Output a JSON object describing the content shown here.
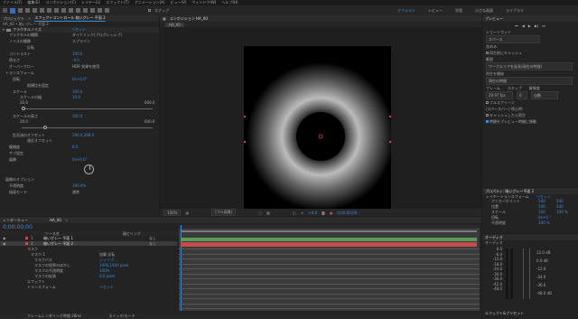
{
  "menu": [
    "ファイル(F)",
    "編集(E)",
    "コンポジション(C)",
    "レイヤー(L)",
    "エフェクト(T)",
    "アニメーション(A)",
    "ビュー(V)",
    "ウィンドウ(W)",
    "ヘルプ(H)"
  ],
  "toolbar": {
    "snap_label": "スナップ"
  },
  "workspaces": {
    "items": [
      "デフォルト",
      "レビュー",
      "学習",
      "小さな画面",
      "ライブラリ"
    ],
    "active": 0
  },
  "effects_panel": {
    "tabs": [
      "プロジェクト",
      "エフェクトコントロール 暗いグレー 平面 2"
    ],
    "breadcrumb": "HA_00 • 暗いグレー 平面 2",
    "effect_name": "フラクタルノイズ",
    "reset_label": "リセット",
    "rows": [
      {
        "label": "フラクタルの種類",
        "value": "ダイナミック(プログレッシブ)"
      },
      {
        "label": "ノイズの種類",
        "value": "スプライン"
      },
      {
        "label": "",
        "value": "反転"
      },
      {
        "label": "コントラスト",
        "value": "100.0"
      },
      {
        "label": "明るさ",
        "value": "-9.0"
      },
      {
        "label": "オーバーフロー",
        "value": "HDR 効果を使用"
      },
      {
        "label": "トランスフォーム",
        "value": ""
      },
      {
        "label": "回転",
        "value": "0x+0.0°"
      },
      {
        "label": "",
        "value": "縦横比を固定"
      },
      {
        "label": "スケール",
        "value": "100.0"
      },
      {
        "label": "スケールの幅",
        "value": "10.0"
      },
      {
        "label": "スケールの高さ",
        "value": "100.0"
      },
      {
        "label": "乱気流のオフセット",
        "value": "290.0,288.0"
      },
      {
        "label": "",
        "value": "遠近オフセット"
      },
      {
        "label": "複雑度",
        "value": "6.0"
      },
      {
        "label": "サブ設定",
        "value": ""
      },
      {
        "label": "展開",
        "value": "0x+0.0°"
      },
      {
        "label": "展開のオプション",
        "value": ""
      },
      {
        "label": "不透明度",
        "value": "100.0%"
      },
      {
        "label": "描画モード",
        "value": "通常"
      }
    ],
    "slider_min": "20.0",
    "slider_max": "600.0"
  },
  "composition_panel": {
    "tab": "コンポジション HA_00",
    "comp_tab": "HA_00",
    "zoom": "100%",
    "resolution": "(フル画質)",
    "timecode": "+0.0",
    "frame": "0;00;00;00"
  },
  "timeline_panel": {
    "tab": "レンダーキュー",
    "comp_tab": "HA_00",
    "timecode": "0;00;00;00",
    "columns": [
      "ソース名",
      "親とリンク"
    ],
    "layers": [
      {
        "num": "1",
        "name": "暗いグレー 平面 1",
        "parent": "なし",
        "color": "#c74b4b"
      },
      {
        "num": "2",
        "name": "暗いグレー 平面 2",
        "parent": "なし",
        "color": "#c74b4b"
      }
    ],
    "sub_rows": [
      {
        "label": "マスク",
        "value": ""
      },
      {
        "label": "マスク 1",
        "value": "加算    反転"
      },
      {
        "label": "マスクパス",
        "value": "シェイプ..."
      },
      {
        "label": "マスクの境界のぼかし",
        "value": "1000,1000 pixel"
      },
      {
        "label": "マスクの不透明度",
        "value": "100%"
      },
      {
        "label": "マスクの拡張",
        "value": "0.0 pixel"
      },
      {
        "label": "エフェクト",
        "value": ""
      },
      {
        "label": "トランスフォーム",
        "value": "リセット"
      }
    ],
    "footer_left": "フレームレンダリング時間  28ms",
    "footer_mid": "スイッチ/モード"
  },
  "preview_panel": {
    "title": "プレビュー",
    "shortcut_label": "ショートカット",
    "shortcut_value": "スペース",
    "include_label": "含める:",
    "cache_label": "再生前にキャッシュ",
    "range_label": "範囲",
    "range_value": "ワークエリアを延長(現在の時間)",
    "play_from_label": "再生を開始",
    "play_from_value": "現在の時間",
    "frame_label": "フレーム",
    "skip_label": "スキップ",
    "res_label": "解像度",
    "frame_value": "29.97 fps",
    "skip_value": "0",
    "res_value": "自動",
    "fullscreen": "フルスクリーン",
    "stop_label": "(スペースバー) 停止時:",
    "cache_option": "キャッシュしたら再生",
    "move_option": "時間をプレビュー時間に移動"
  },
  "properties_panel": {
    "title": "プロパティ: 暗いグレー平面 2",
    "section": "レイヤートランスフォーム",
    "reset": "リセット",
    "rows": [
      {
        "label": "アンカーポイント",
        "v1": "540",
        "v2": "540"
      },
      {
        "label": "位置",
        "v1": "540",
        "v2": "540"
      },
      {
        "label": "スケール",
        "v1": "100",
        "v2": "100 %"
      },
      {
        "label": "回転",
        "v1": "0x+0 °",
        "v2": ""
      },
      {
        "label": "不透明度",
        "v1": "100 %",
        "v2": ""
      }
    ]
  },
  "audio_panel": {
    "tab": "オーディオ",
    "title": "オーディオ",
    "levels": [
      "0.0",
      "-6.0",
      "-12.0",
      "-18.0",
      "-24.0",
      "-30.0",
      "-36.0",
      "-42.0",
      "-48.0"
    ],
    "levels_right": [
      "12.0 dB",
      "0.0 dB",
      "-12.0",
      "-24.0",
      "-36.0",
      "-48.0 dB"
    ]
  },
  "effects_presets": {
    "title": "エフェクト&プリセット"
  },
  "colors": {
    "accent": "#3a8be0",
    "selection": "#c74b4b",
    "track_green": "#5a9c5a"
  }
}
